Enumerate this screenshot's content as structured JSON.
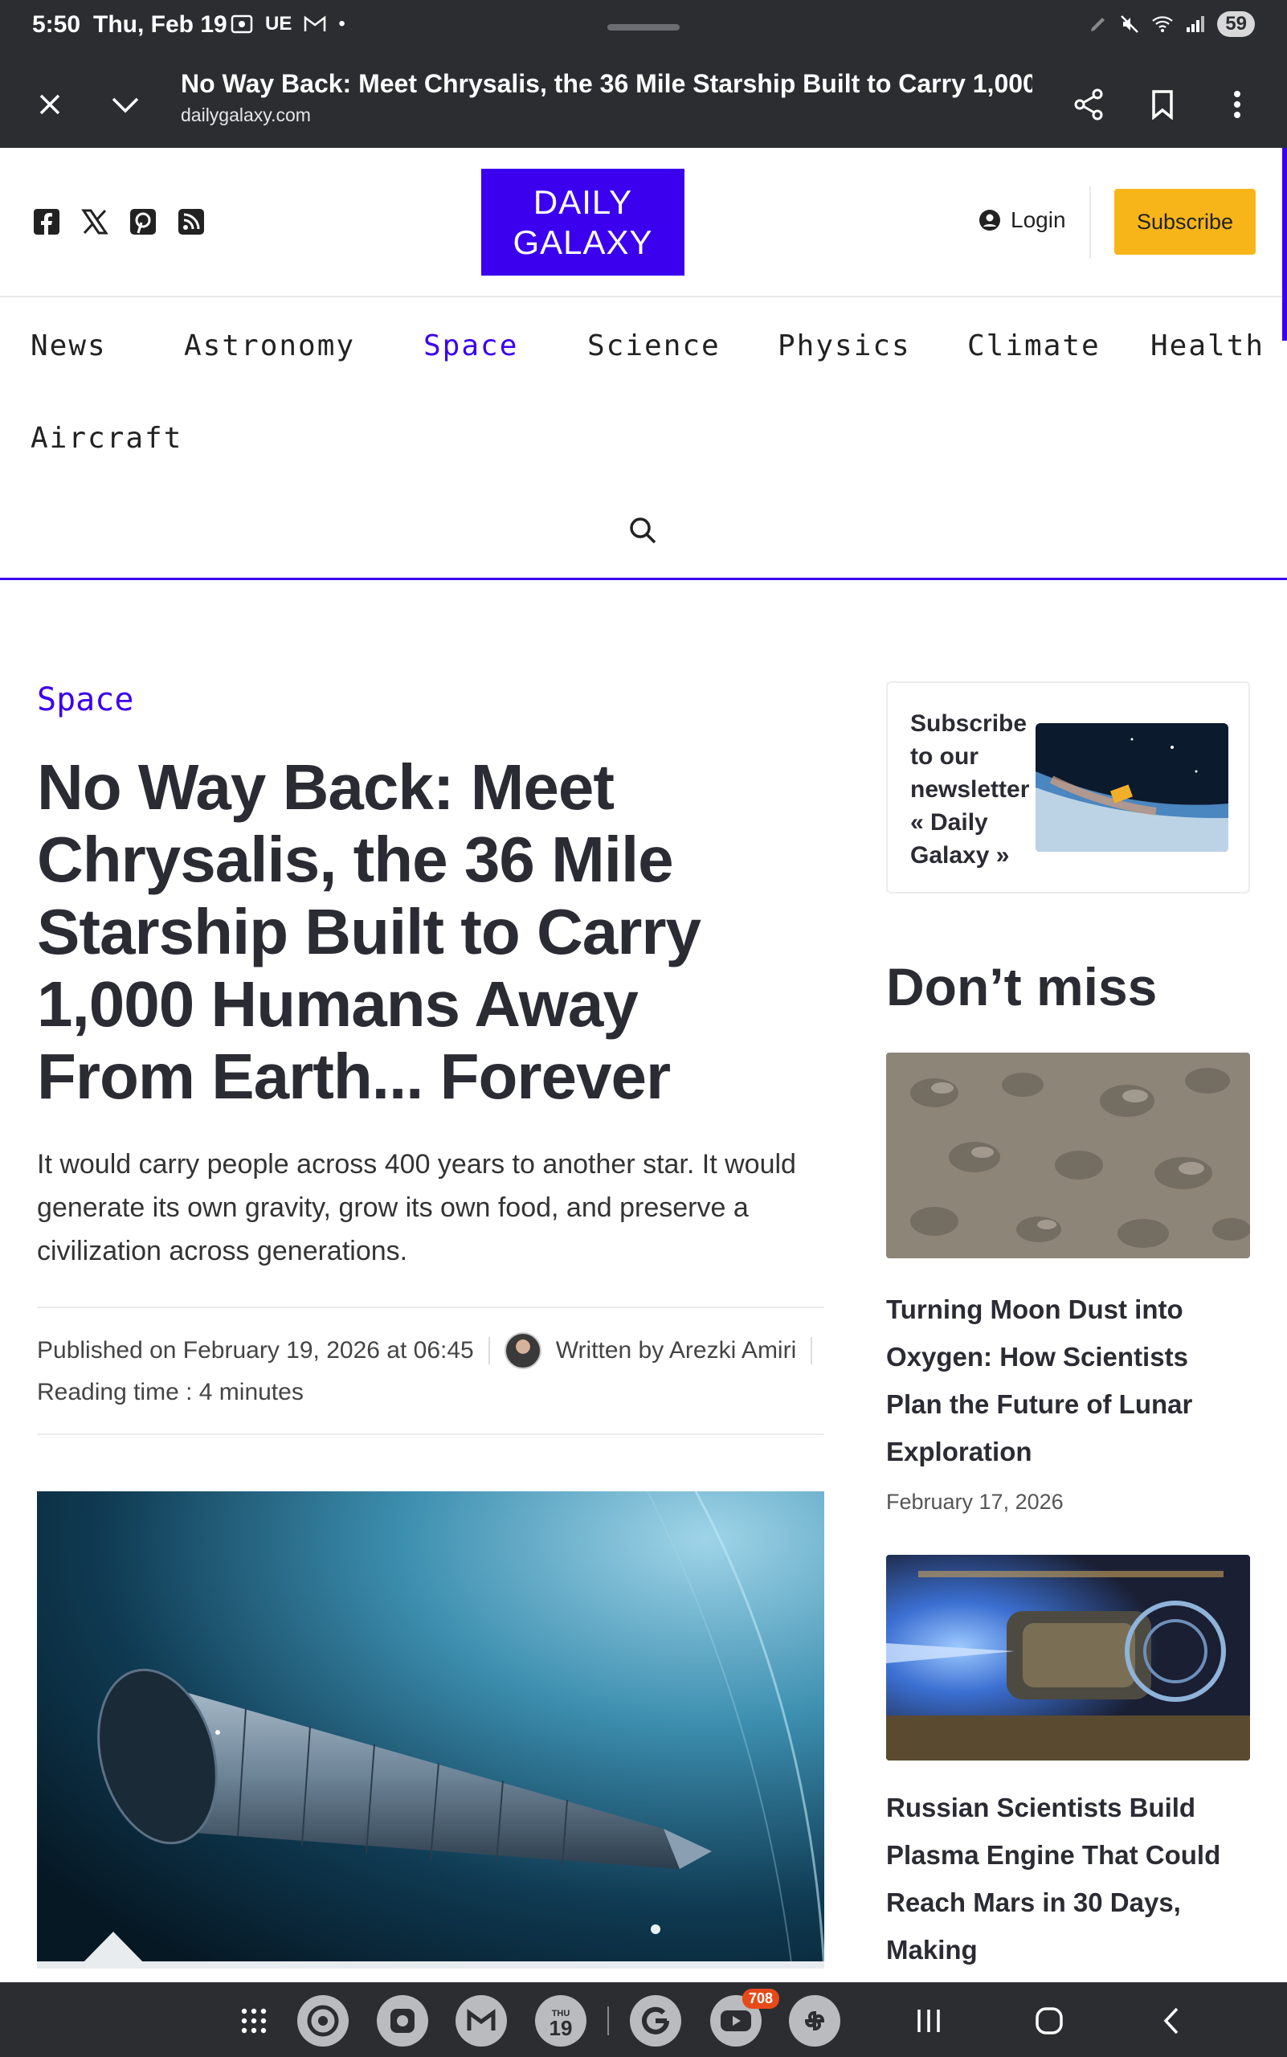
{
  "status_bar": {
    "time": "5:50",
    "date": "Thu, Feb 19",
    "indicators": [
      "screen-record-icon",
      "UE",
      "gmail-icon",
      "•"
    ],
    "battery": "59"
  },
  "tab_bar": {
    "page_title": "No Way Back: Meet Chrysalis, the 36 Mile Starship Built to Carry 1,000 Human...",
    "url": "dailygalaxy.com"
  },
  "header": {
    "logo_line1": "DAILY",
    "logo_line2": "GALAXY",
    "login_label": "Login",
    "subscribe_label": "Subscribe",
    "social": [
      "facebook-icon",
      "x-icon",
      "pinterest-icon",
      "rss-icon"
    ]
  },
  "nav": {
    "items": [
      "News",
      "Astronomy",
      "Space",
      "Science",
      "Physics",
      "Climate",
      "Health",
      "Aircraft"
    ],
    "active": "Space"
  },
  "article": {
    "category": "Space",
    "headline": "No Way Back: Meet Chrysalis, the 36 Mile Starship Built to Carry 1,000 Humans Away From Earth... Forever",
    "dek": "It would carry people across 400 years to another star. It would generate its own gravity, grow its own food, and preserve a civilization across generations.",
    "published": "Published on February 19, 2026 at 06:45",
    "author": "Written by Arezki Amiri",
    "reading_time": "Reading time : 4 minutes"
  },
  "sidebar": {
    "newsletter_text": "Subscribe to our newsletter « Daily Galaxy »",
    "dont_miss": "Don’t miss",
    "cards": [
      {
        "title": "Turning Moon Dust into Oxygen: How Scientists Plan the Future of Lunar Exploration",
        "date": "February 17, 2026"
      },
      {
        "title": "Russian Scientists Build Plasma Engine That Could Reach Mars in 30 Days, Making",
        "date": ""
      }
    ]
  },
  "bottom_bar": {
    "calendar_day": "THU",
    "calendar_date": "19",
    "youtube_badge": "708"
  },
  "colors": {
    "brand": "#3b00ee",
    "subscribe": "#f7b51a",
    "chrome": "#2b2d31"
  }
}
